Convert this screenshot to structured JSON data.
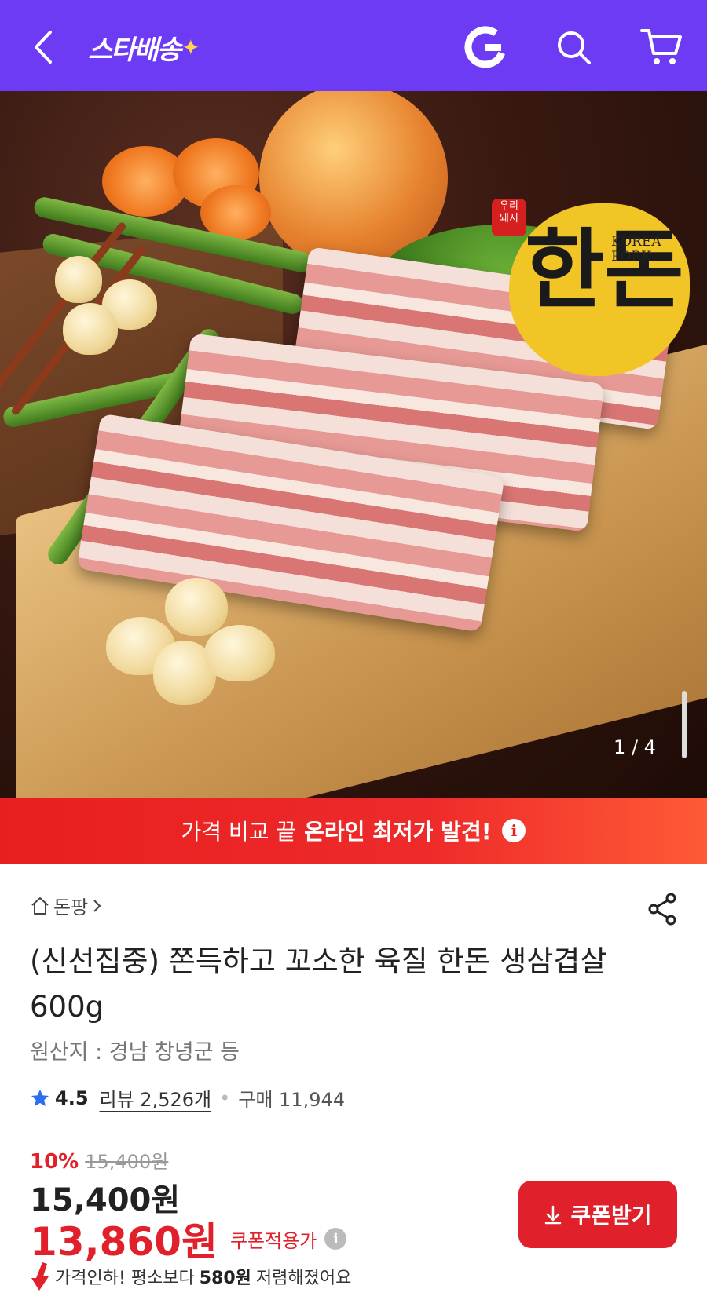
{
  "header": {
    "logo_text": "스타배송",
    "logo_spark": "✦",
    "icons": [
      "back-arrow-icon",
      "gmarket-g-icon",
      "search-icon",
      "cart-icon"
    ],
    "color": "#6e3bf5"
  },
  "hero": {
    "badge_red": "우리\n돼지",
    "badge_hanja": "한돈",
    "badge_brand": "KOREA\nPORK",
    "pager": "1 / 4"
  },
  "promo": {
    "prefix": "가격 비교 끝",
    "highlight": "온라인 최저가 발견!",
    "info": "i"
  },
  "product": {
    "breadcrumb": "돈팡",
    "title": "(신선집중) 쫀득하고 꼬소한 육질 한돈 생삼겹살 600g",
    "origin": "원산지 : 경남 창녕군 등",
    "rating": "4.5",
    "reviews": "리뷰 2,526개",
    "purchases": "구매 11,944",
    "discount_pct": "10%",
    "original_price": "15,400원",
    "price": "15,400원",
    "coupon_price": "13,860원",
    "coupon_label": "쿠폰적용가",
    "coupon_button": "쿠폰받기",
    "drop_prefix": "가격인하! 평소보다",
    "drop_amount": "580원",
    "drop_suffix": "저렴해졌어요"
  },
  "colors": {
    "accent_red": "#e0202a",
    "header_purple": "#6e3bf5"
  }
}
